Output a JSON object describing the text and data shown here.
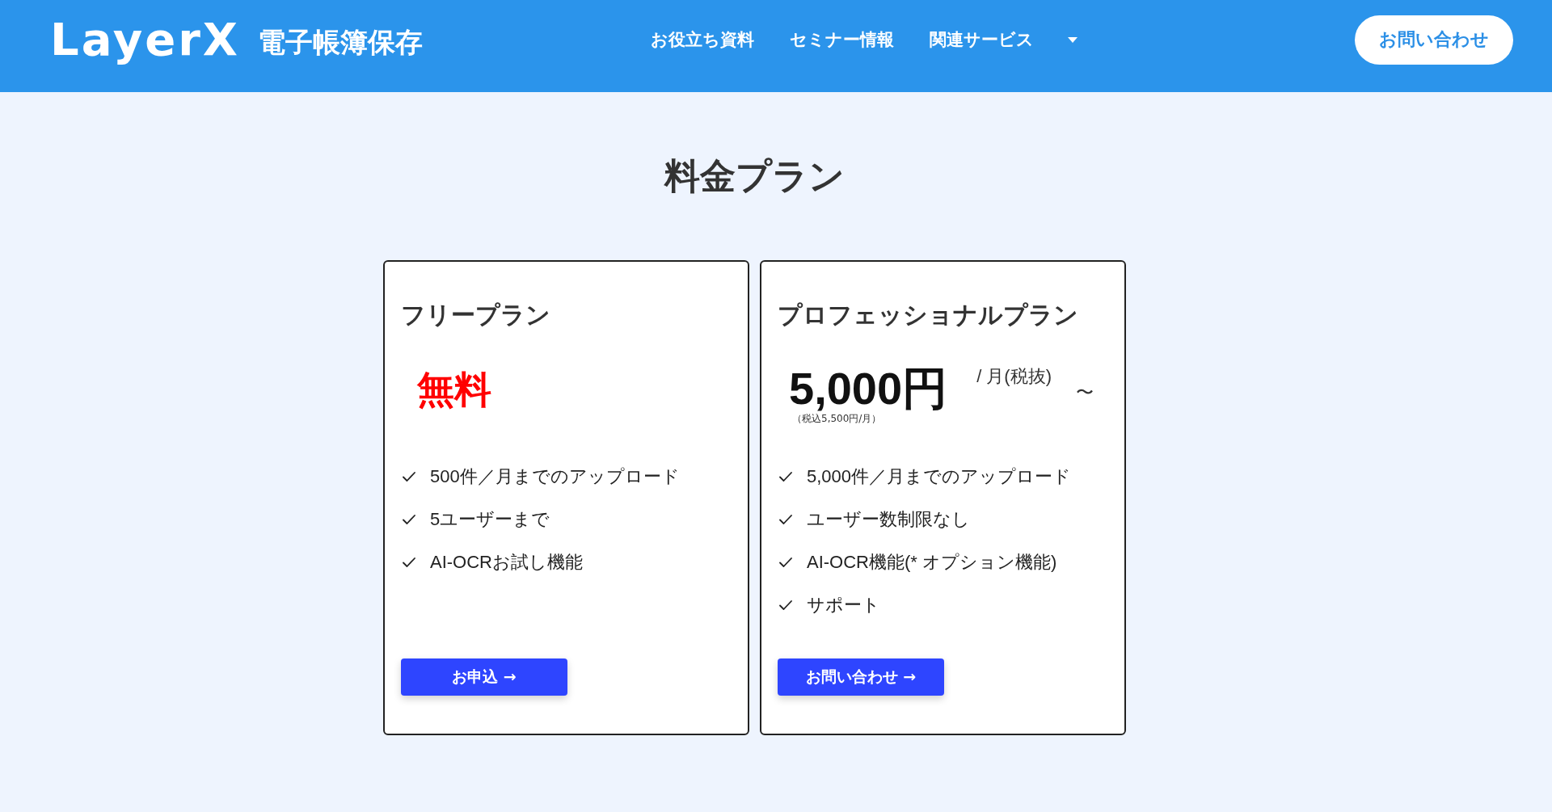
{
  "header": {
    "logo": {
      "brand": "LayerX",
      "product": "電子帳簿保存"
    },
    "nav": [
      {
        "label": "お役立ち資料",
        "kind": "link"
      },
      {
        "label": "セミナー情報",
        "kind": "link"
      },
      {
        "label": "関連サービス",
        "kind": "dropdown"
      }
    ],
    "contact_button": "お問い合わせ"
  },
  "pricing": {
    "title": "料金プラン",
    "plans": [
      {
        "name": "フリープラン",
        "price": {
          "kind": "free",
          "amount": "無料"
        },
        "features": [
          "500件／月までのアップロード",
          "5ユーザーまで",
          "AI-OCRお試し機能"
        ],
        "button": "お申込 →"
      },
      {
        "name": "プロフェッショナルプラン",
        "price": {
          "kind": "paid",
          "amount": "5,000円",
          "unit": "/ 月(税抜)",
          "suffix": "〜",
          "tax_note": "（税込5,500円/月）"
        },
        "features": [
          "5,000件／月までのアップロード",
          "ユーザー数制限なし",
          "AI-OCR機能(* オプション機能)",
          "サポート"
        ],
        "button": "お問い合わせ →"
      }
    ]
  }
}
